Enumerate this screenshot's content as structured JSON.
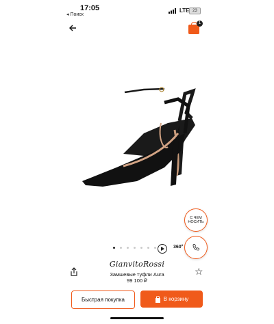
{
  "status_bar": {
    "time": "17:05",
    "back_app": "◂ Поиск",
    "network": "LTE",
    "battery": "23"
  },
  "header": {
    "cart_count": "1"
  },
  "product": {
    "brand": "GianvitoRossi",
    "name": "Замшевые туфли Aura",
    "price": "99 100 ₽"
  },
  "gallery": {
    "image_count": 8,
    "active_index": 0,
    "view360_label": "360°"
  },
  "floating": {
    "wear_label_line1": "С ЧЕМ",
    "wear_label_line2": "НОСИТЬ"
  },
  "actions": {
    "quick_buy_label": "Быстрая покупка",
    "add_to_cart_label": "В корзину"
  },
  "colors": {
    "accent": "#f05a1a"
  }
}
